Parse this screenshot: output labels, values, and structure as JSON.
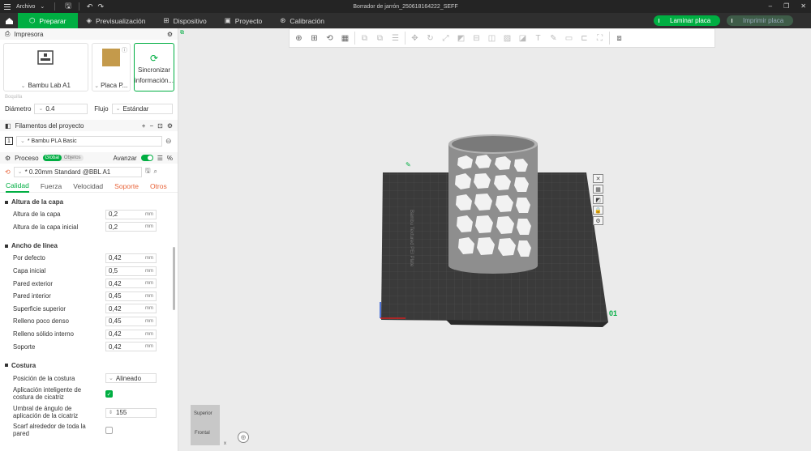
{
  "titlebar": {
    "menu_label": "Archivo",
    "title": "Borrador de jarrón_250618164222_SEFF"
  },
  "tabs": [
    {
      "label": "Preparar",
      "icon": "cube-icon"
    },
    {
      "label": "Previsualización",
      "icon": "layers-icon"
    },
    {
      "label": "Dispositivo",
      "icon": "device-icon"
    },
    {
      "label": "Proyecto",
      "icon": "project-icon"
    },
    {
      "label": "Calibración",
      "icon": "calibration-icon"
    }
  ],
  "actions": {
    "slice": "Laminar placa",
    "print": "Imprimir placa"
  },
  "printer": {
    "header": "Impresora",
    "printer_name": "Bambu Lab A1",
    "plate_name": "Placa P...",
    "sync_label_1": "Sincronizar",
    "sync_label_2": "información...",
    "nozzle_label": "Boquilla",
    "diameter_label": "Diámetro",
    "diameter_value": "0.4",
    "flow_label": "Flujo",
    "flow_value": "Estándar"
  },
  "filaments": {
    "header": "Filamentos del proyecto",
    "index": "1",
    "name": "* Bambu PLA Basic"
  },
  "process": {
    "header": "Proceso",
    "toggle_global": "Global",
    "toggle_objects": "Objetos",
    "advanced_label": "Avanzar",
    "preset": "* 0.20mm Standard @BBL A1"
  },
  "subtabs": [
    {
      "label": "Calidad",
      "state": "active"
    },
    {
      "label": "Fuerza",
      "state": "normal"
    },
    {
      "label": "Velocidad",
      "state": "normal"
    },
    {
      "label": "Soporte",
      "state": "warn"
    },
    {
      "label": "Otros",
      "state": "warn"
    }
  ],
  "groups": {
    "layer_height": {
      "title": "Altura de la capa",
      "rows": [
        {
          "label": "Altura de la capa",
          "value": "0,2",
          "unit": "mm"
        },
        {
          "label": "Altura de la capa inicial",
          "value": "0,2",
          "unit": "mm"
        }
      ]
    },
    "line_width": {
      "title": "Ancho de línea",
      "rows": [
        {
          "label": "Por defecto",
          "value": "0,42",
          "unit": "mm"
        },
        {
          "label": "Capa inicial",
          "value": "0,5",
          "unit": "mm"
        },
        {
          "label": "Pared exterior",
          "value": "0,42",
          "unit": "mm"
        },
        {
          "label": "Pared interior",
          "value": "0,45",
          "unit": "mm"
        },
        {
          "label": "Superficie superior",
          "value": "0,42",
          "unit": "mm"
        },
        {
          "label": "Relleno poco denso",
          "value": "0,45",
          "unit": "mm"
        },
        {
          "label": "Relleno sólido interno",
          "value": "0,42",
          "unit": "mm"
        },
        {
          "label": "Soporte",
          "value": "0,42",
          "unit": "mm"
        }
      ]
    },
    "seam": {
      "title": "Costura",
      "position_label": "Posición de la costura",
      "position_value": "Alineado",
      "smart_label_1": "Aplicación inteligente de",
      "smart_label_2": "costura de cicatriz",
      "angle_label_1": "Umbral de ángulo de",
      "angle_label_2": "aplicación de la cicatriz",
      "angle_value": "155",
      "scarf_label_1": "Scarf alrededor de toda la",
      "scarf_label_2": "pared"
    }
  },
  "viewport": {
    "plate_number": "01",
    "plate_text": "Bambu Textured PEI Plate",
    "cube_top": "Superior",
    "cube_front": "Frontal",
    "axis_x": "x"
  },
  "colors": {
    "accent": "#00ae42",
    "warn": "#e8643a"
  }
}
